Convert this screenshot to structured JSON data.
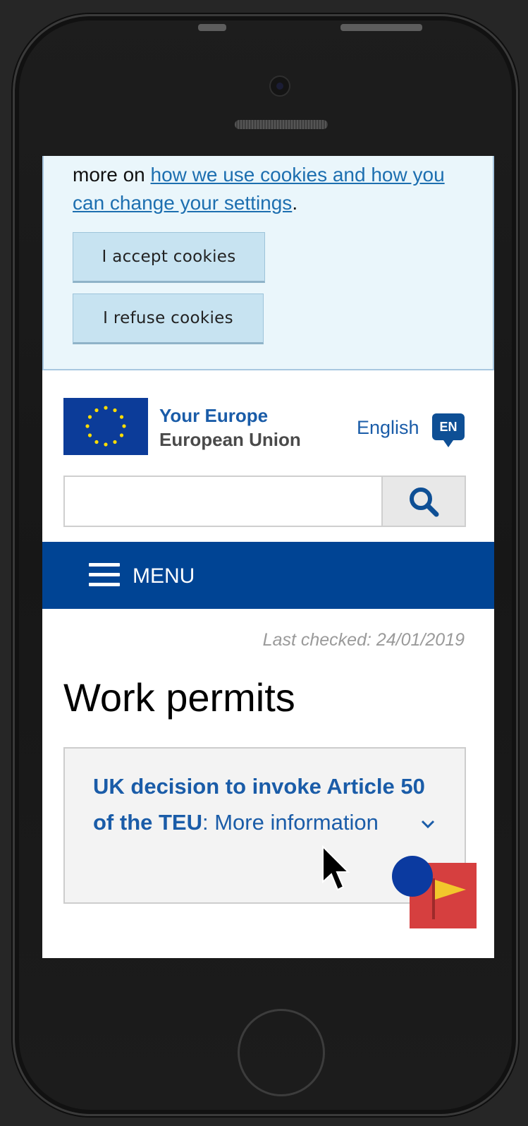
{
  "cookie_banner": {
    "text_prefix": "more on ",
    "link_text": "how we use cookies and how you can change your settings",
    "text_suffix": ".",
    "accept_label": "I accept cookies",
    "refuse_label": "I refuse cookies"
  },
  "header": {
    "brand_line1": "Your Europe",
    "brand_line2": "European Union",
    "language_label": "English",
    "language_code": "EN"
  },
  "search": {
    "value": "",
    "placeholder": ""
  },
  "menu": {
    "label": "MENU"
  },
  "content": {
    "last_checked": "Last checked: 24/01/2019",
    "title": "Work permits",
    "notice_bold": "UK decision to invoke Article 50 of the TEU",
    "notice_rest": ": More information"
  },
  "colors": {
    "eu_blue": "#004494",
    "link_blue": "#1a5ca8",
    "cookie_bg": "#eaf6fb",
    "cookie_button": "#c7e3f1"
  },
  "icons": {
    "search": "search-icon",
    "menu": "hamburger-menu-icon",
    "chevron": "chevron-down-icon",
    "flag": "flag-icon"
  }
}
